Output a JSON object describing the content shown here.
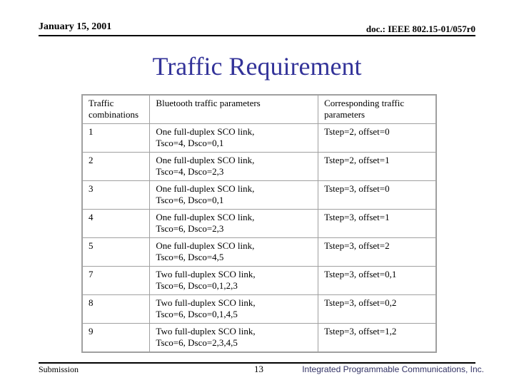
{
  "header": {
    "date": "January 15, 2001",
    "doc_id": "doc.: IEEE 802.15-01/057r0"
  },
  "title": "Traffic Requirement",
  "table": {
    "headers": [
      "Traffic combinations",
      "Bluetooth traffic parameters",
      "Corresponding traffic parameters"
    ],
    "rows": [
      {
        "combo": "1",
        "bt_line1": "One full-duplex SCO link,",
        "bt_line2": "Tsco=4, Dsco=0,1",
        "corr": "Tstep=2, offset=0"
      },
      {
        "combo": "2",
        "bt_line1": "One full-duplex SCO link,",
        "bt_line2": "Tsco=4, Dsco=2,3",
        "corr": "Tstep=2, offset=1"
      },
      {
        "combo": "3",
        "bt_line1": "One full-duplex SCO link,",
        "bt_line2": "Tsco=6, Dsco=0,1",
        "corr": "Tstep=3, offset=0"
      },
      {
        "combo": "4",
        "bt_line1": "One full-duplex SCO link,",
        "bt_line2": "Tsco=6, Dsco=2,3",
        "corr": "Tstep=3, offset=1"
      },
      {
        "combo": "5",
        "bt_line1": "One full-duplex SCO link,",
        "bt_line2": "Tsco=6, Dsco=4,5",
        "corr": "Tstep=3, offset=2"
      },
      {
        "combo": "7",
        "bt_line1": "Two full-duplex SCO link,",
        "bt_line2": "Tsco=6, Dsco=0,1,2,3",
        "corr": "Tstep=3, offset=0,1"
      },
      {
        "combo": "8",
        "bt_line1": "Two full-duplex SCO link,",
        "bt_line2": "Tsco=6, Dsco=0,1,4,5",
        "corr": "Tstep=3, offset=0,2"
      },
      {
        "combo": "9",
        "bt_line1": "Two full-duplex SCO link,",
        "bt_line2": "Tsco=6, Dsco=2,3,4,5",
        "corr": "Tstep=3, offset=1,2"
      }
    ]
  },
  "footer": {
    "left": "Submission",
    "page_number": "13",
    "company": "Integrated Programmable Communications, Inc."
  },
  "colors": {
    "title": "#333399",
    "table_border": "#a0a0a0",
    "company": "#333366"
  }
}
